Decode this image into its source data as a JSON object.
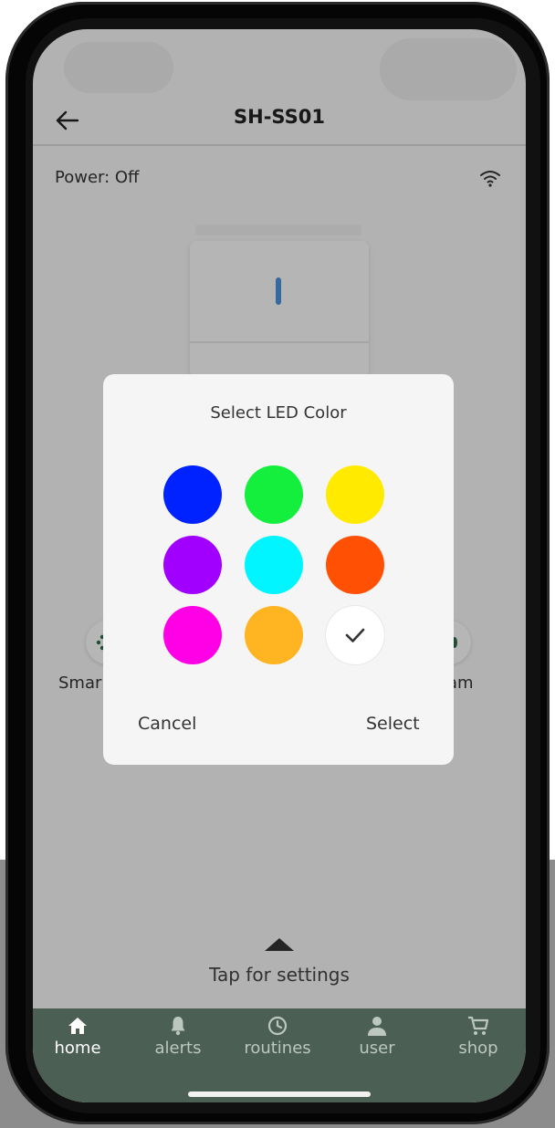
{
  "app": {
    "title": "SH-SS01",
    "power_status": "Power: Off"
  },
  "side_labels": {
    "left": "Smar",
    "right": "am"
  },
  "settings_hint": "Tap for settings",
  "dialog": {
    "title": "Select LED Color",
    "cancel_label": "Cancel",
    "select_label": "Select",
    "colors": [
      "#0022ff",
      "#14ee3c",
      "#ffea00",
      "#a100ff",
      "#00f5ff",
      "#ff5004",
      "#ff00e6",
      "#ffb422",
      "#ffffff"
    ],
    "selected_color": "#ffffff"
  },
  "tabs": [
    {
      "label": "home",
      "icon": "home-icon",
      "active": true
    },
    {
      "label": "alerts",
      "icon": "bell-icon",
      "active": false
    },
    {
      "label": "routines",
      "icon": "clock-icon",
      "active": false
    },
    {
      "label": "user",
      "icon": "user-icon",
      "active": false
    },
    {
      "label": "shop",
      "icon": "cart-icon",
      "active": false
    }
  ],
  "theme": {
    "tabbar": "#4b5f54",
    "led": "#4a90d8"
  }
}
